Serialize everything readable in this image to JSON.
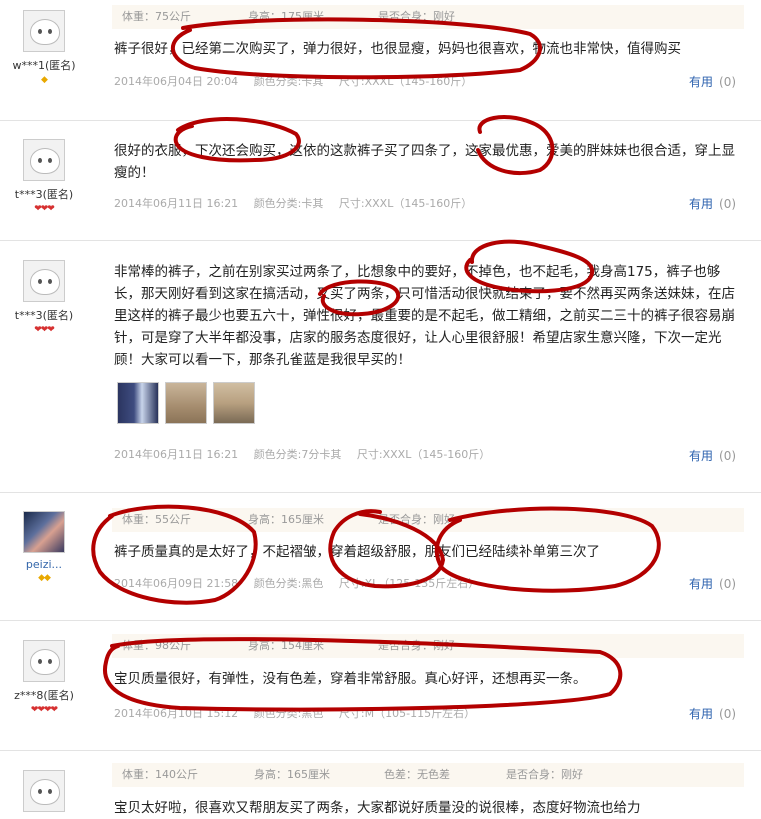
{
  "reviews": [
    {
      "user": "w***1(匿名)",
      "badge": "◆",
      "meta": {
        "weight": "体重：75公斤",
        "height": "身高：175厘米",
        "fit": "是否合身：刚好"
      },
      "comment": "裤子很好，已经第二次购买了，弹力很好，也很显瘦，妈妈也很喜欢，物流也非常快，值得购买",
      "date": "2014年06月04日 20:04",
      "color": "颜色分类:卡其",
      "size": "尺寸:XXXL（145-160斤）",
      "useful": "有用",
      "count": "(0)"
    },
    {
      "user": "t***3(匿名)",
      "badge": "❤❤❤",
      "comment": "很好的衣服，下次还会购买，这依的这款裤子买了四条了，这家最优惠，爱美的胖妹妹也很合适，穿上显瘦的！",
      "date": "2014年06月11日 16:21",
      "color": "颜色分类:卡其",
      "size": "尺寸:XXXL（145-160斤）",
      "useful": "有用",
      "count": "(0)"
    },
    {
      "user": "t***3(匿名)",
      "badge": "❤❤❤",
      "comment": "非常棒的裤子，之前在别家买过两条了，比想象中的要好，不掉色，也不起毛，我身高175，裤子也够长，那天刚好看到这家在搞活动，又买了两条，只可惜活动很快就结束了，要不然再买两条送妹妹，在店里这样的裤子最少也要五六十，弹性很好，最重要的是不起毛，做工精细，之前买二三十的裤子很容易崩针，可是穿了大半年都没事，店家的服务态度很好，让人心里很舒服！希望店家生意兴隆，下次一定光顾！大家可以看一下，那条孔雀蓝是我很早买的！",
      "date": "2014年06月11日 16:21",
      "color": "颜色分类:7分卡其",
      "size": "尺寸:XXXL（145-160斤）",
      "useful": "有用",
      "count": "(0)"
    },
    {
      "user": "peizi...",
      "badge": "◆◆",
      "meta": {
        "weight": "体重：55公斤",
        "height": "身高：165厘米",
        "fit": "是否合身：刚好"
      },
      "comment": "裤子质量真的是太好了，不起褶皱，穿着超级舒服，朋友们已经陆续补单第三次了",
      "date": "2014年06月09日 21:58",
      "color": "颜色分类:黑色",
      "size": "尺寸:XL（125-135斤左右）",
      "useful": "有用",
      "count": "(0)"
    },
    {
      "user": "z***8(匿名)",
      "badge": "❤❤❤❤",
      "meta": {
        "weight": "体重：98公斤",
        "height": "身高：154厘米",
        "fit": "是否合身：刚好"
      },
      "comment": "宝贝质量很好，有弹性，没有色差，穿着非常舒服。真心好评，还想再买一条。",
      "date": "2014年06月10日 15:12",
      "color": "颜色分类:黑色",
      "size": "尺寸:M（105-115斤左右）",
      "useful": "有用",
      "count": "(0)"
    },
    {
      "meta": {
        "weight": "体重：140公斤",
        "height": "身高：165厘米",
        "colordiff": "色差：无色差",
        "fit": "是否合身：刚好"
      },
      "comment": "宝贝太好啦，很喜欢又帮朋友买了两条，大家都说好质量没的说很棒，态度好物流也给力"
    }
  ],
  "icons": {
    "avatar": "default-avatar-face-icon",
    "gem": "diamond-icon",
    "heart": "heart-icon"
  },
  "colors": {
    "annotation": "#b30000",
    "link": "#2d62ae",
    "meta_bg": "#fbf7f0"
  }
}
